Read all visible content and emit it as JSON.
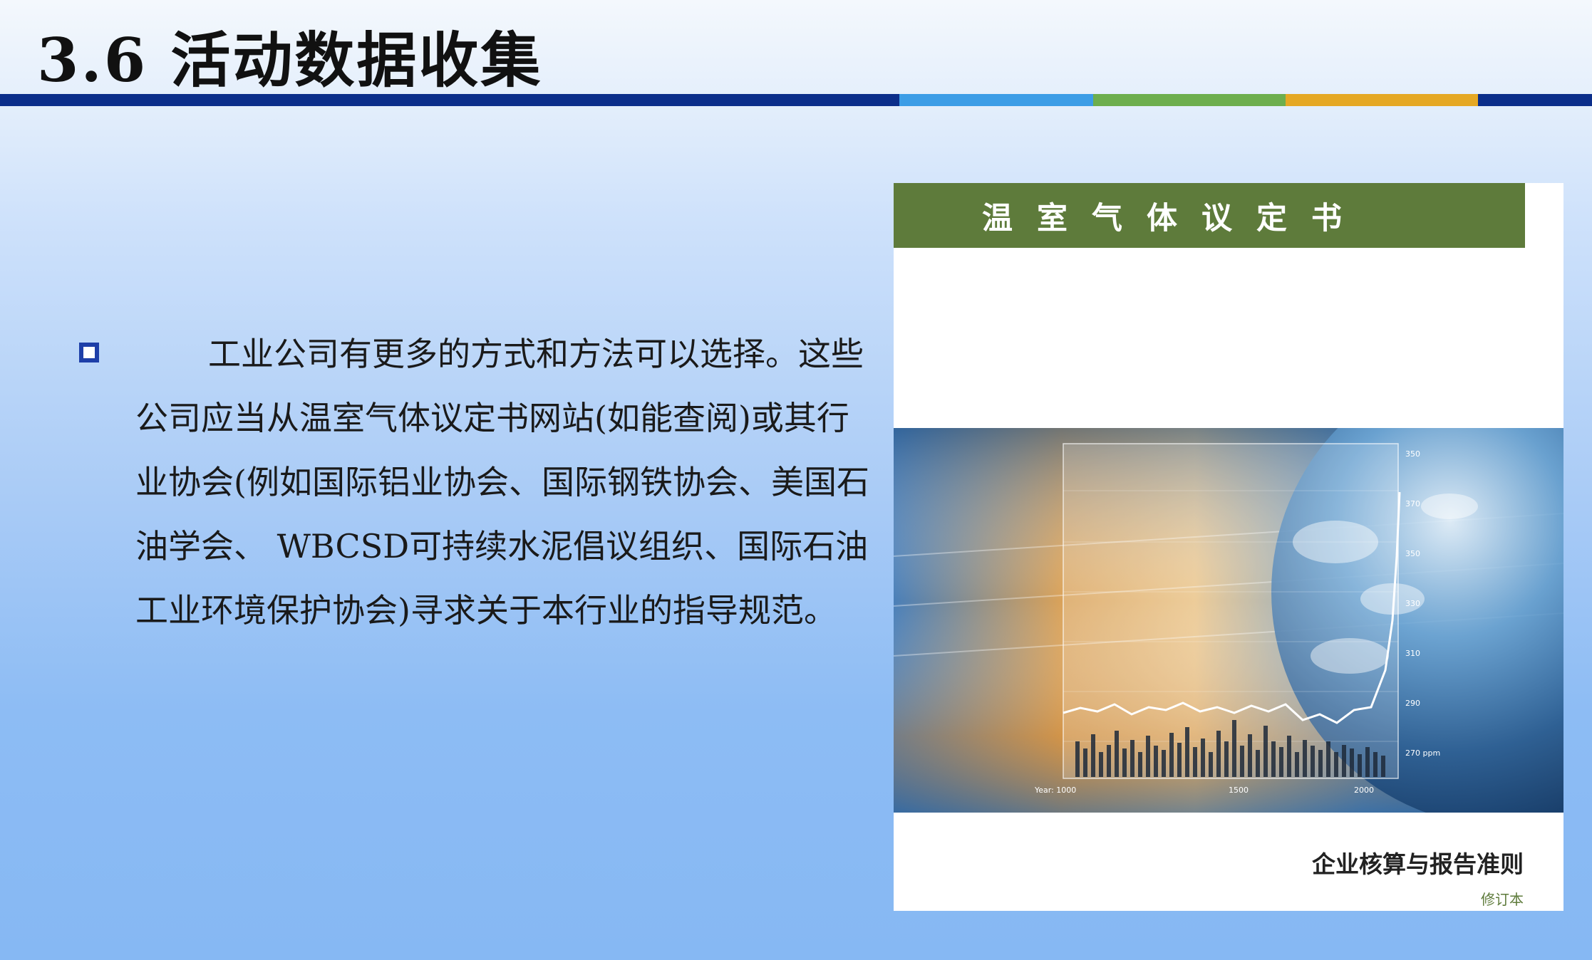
{
  "slide": {
    "title": "3.6  活动数据收集",
    "accent_colors": [
      "#0b2e8a",
      "#3c9de6",
      "#6dae4d",
      "#e5a824",
      "#0b2e8a"
    ],
    "bullet_icon": "hollow-square-bullet-icon",
    "body_text": "工业公司有更多的方式和方法可以选择。这些公司应当从温室气体议定书网站(如能查阅)或其行业协会(例如国际铝业协会、国际钢铁协会、美国石油学会、 WBCSD可持续水泥倡议组织、国际石油工业环境保护协会)寻求关于本行业的指导规范。"
  },
  "book_cover": {
    "band_title": "温室气体议定书",
    "band_color": "#5e7b3b",
    "subtitle": "企业核算与报告准则",
    "edition": "修订本",
    "image": {
      "description_icon": "globe-and-co2-chart-image",
      "axis_x_labels": [
        "Year: 1000",
        "1500",
        "2000"
      ],
      "axis_y_labels": [
        "350",
        "370",
        "350",
        "330",
        "310",
        "290",
        "270 ppm"
      ]
    }
  }
}
